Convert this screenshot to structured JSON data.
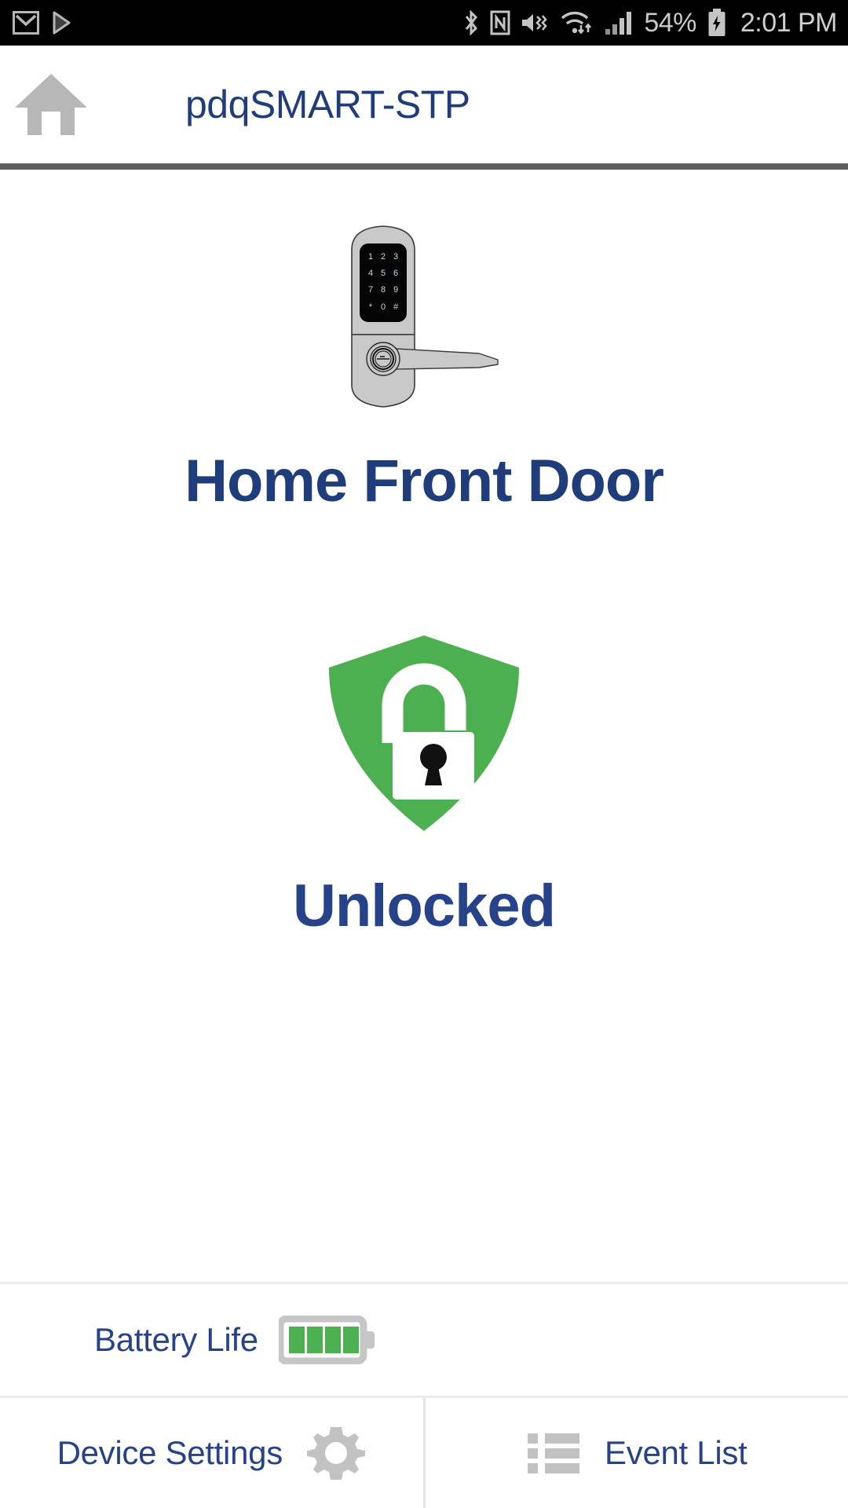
{
  "status_bar": {
    "icons_left": [
      "gmail-icon",
      "play-store-icon"
    ],
    "icons_right": [
      "bluetooth-icon",
      "nfc-icon",
      "mute-vibrate-icon",
      "wifi-icon",
      "cellular-signal-icon"
    ],
    "battery_percent": "54%",
    "battery_state": "charging-battery-icon",
    "time": "2:01 PM"
  },
  "header": {
    "home_icon": "home-icon",
    "title": "pdqSMART-STP"
  },
  "device": {
    "image_name": "smart-lock-keypad-image",
    "keypad_keys": [
      "1",
      "2",
      "3",
      "4",
      "5",
      "6",
      "7",
      "8",
      "9",
      "*",
      "0",
      "#"
    ],
    "name": "Home Front Door"
  },
  "lock_status": {
    "icon": "shield-unlocked-icon",
    "label": "Unlocked",
    "state_color": "#4caf50"
  },
  "battery": {
    "label": "Battery Life",
    "icon": "battery-icon",
    "bars_filled": 4,
    "bars_total": 4
  },
  "bottom_bar": {
    "buttons": [
      {
        "label": "Device Settings",
        "icon": "gear-icon"
      },
      {
        "label": "Event List",
        "icon": "list-icon"
      }
    ]
  },
  "colors": {
    "brand_navy": "#1f3d7a",
    "text_blue": "#26438a",
    "green": "#4caf50",
    "icon_gray": "#b7b7b7",
    "divider_dark": "#5e5e5e"
  }
}
